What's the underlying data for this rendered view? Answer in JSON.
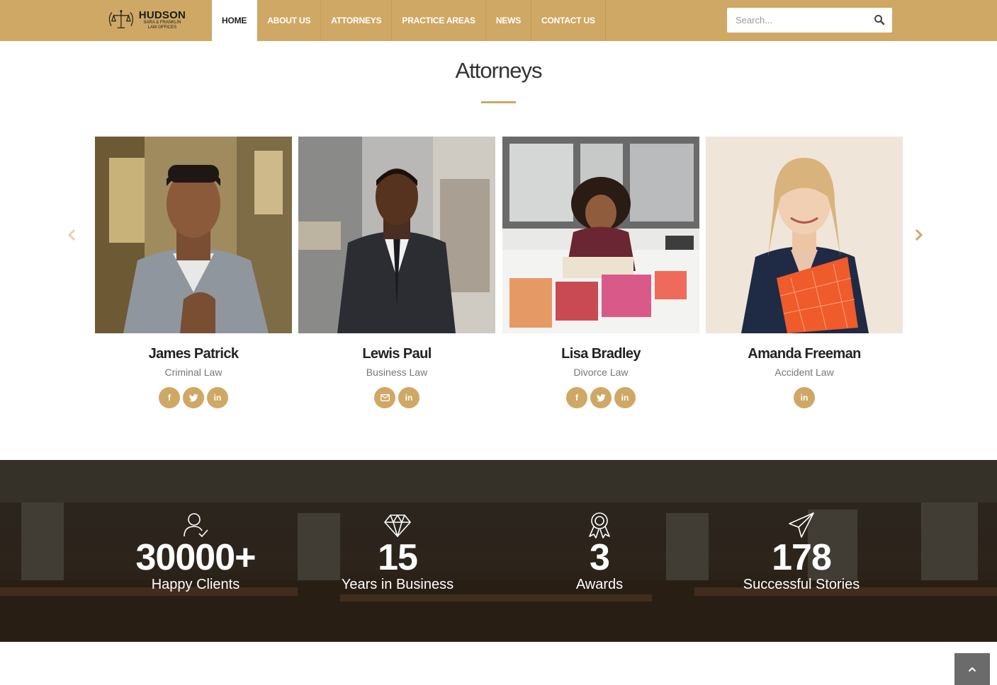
{
  "header": {
    "logo": {
      "name": "HUDSON",
      "sub1": "SARA & FRANKLIN",
      "sub2": "LAW OFFICES"
    },
    "nav": [
      {
        "label": "HOME",
        "active": true
      },
      {
        "label": "ABOUT US"
      },
      {
        "label": "ATTORNEYS"
      },
      {
        "label": "PRACTICE AREAS"
      },
      {
        "label": "NEWS"
      },
      {
        "label": "CONTACT US"
      }
    ],
    "search": {
      "placeholder": "Search...",
      "icon": "search-icon"
    }
  },
  "section": {
    "title": "Attorneys"
  },
  "carousel": {
    "prev_icon": "chevron-left-icon",
    "next_icon": "chevron-right-icon",
    "attorneys": [
      {
        "name": "James Patrick",
        "role": "Criminal Law",
        "social": [
          "facebook-icon",
          "twitter-icon",
          "linkedin-icon"
        ]
      },
      {
        "name": "Lewis Paul",
        "role": "Business Law",
        "social": [
          "email-icon",
          "linkedin-icon"
        ]
      },
      {
        "name": "Lisa Bradley",
        "role": "Divorce Law",
        "social": [
          "facebook-icon",
          "twitter-icon",
          "linkedin-icon"
        ]
      },
      {
        "name": "Amanda Freeman",
        "role": "Accident Law",
        "social": [
          "linkedin-icon"
        ]
      }
    ]
  },
  "stats": [
    {
      "icon": "user-check-icon",
      "value": "30000+",
      "label": "Happy Clients"
    },
    {
      "icon": "diamond-icon",
      "value": "15",
      "label": "Years in Business"
    },
    {
      "icon": "award-icon",
      "value": "3",
      "label": "Awards"
    },
    {
      "icon": "paper-plane-icon",
      "value": "178",
      "label": "Successful Stories"
    }
  ],
  "scroll_top": {
    "icon": "chevron-up-icon"
  },
  "colors": {
    "accent": "#cfa865",
    "dark": "#222222"
  }
}
